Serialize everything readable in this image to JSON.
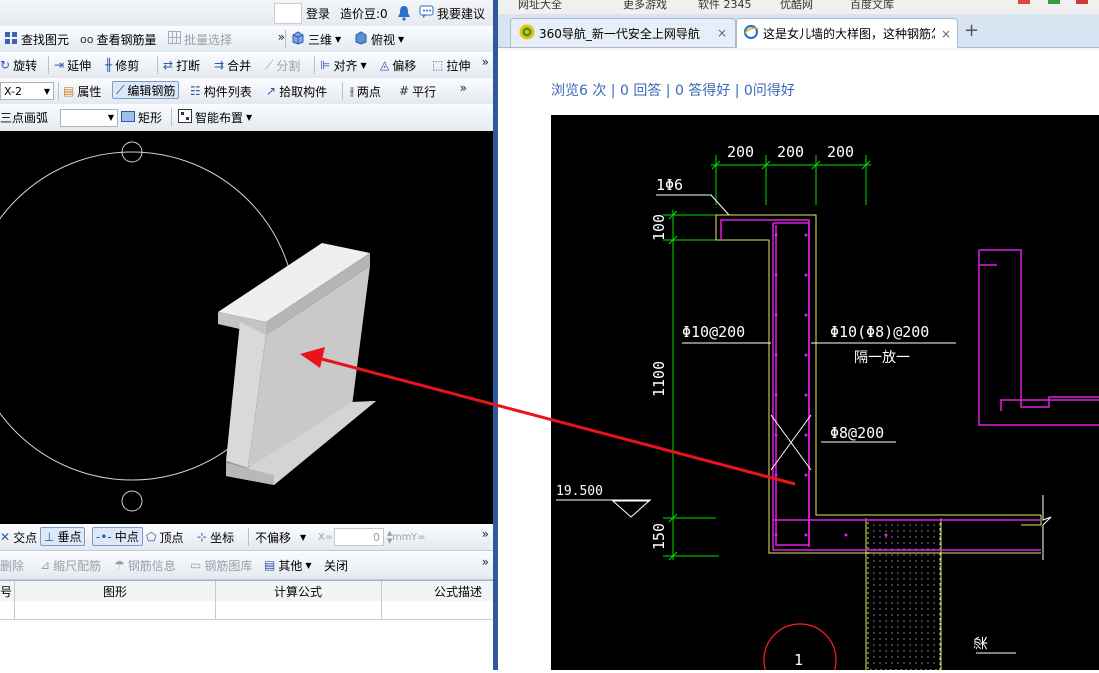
{
  "left_app": {
    "title_bar": {
      "login": "登录",
      "coins": "造价豆:0",
      "suggest": "我要建议"
    },
    "toolbar1": {
      "find": "查找图元",
      "view_rebar": "查看钢筋量",
      "batch_select": "批量选择",
      "view3d": "三维",
      "top_view": "俯视"
    },
    "toolbar2": {
      "rotate": "旋转",
      "extend": "延伸",
      "trim": "修剪",
      "break": "打断",
      "merge": "合并",
      "split": "分割",
      "align": "对齐",
      "offset": "偏移",
      "stretch": "拉伸"
    },
    "toolbar3": {
      "layer_combo": "X-2",
      "properties": "属性",
      "edit_rebar": "编辑钢筋",
      "component_list": "构件列表",
      "pick_component": "拾取构件",
      "two_points": "两点",
      "parallel": "平行"
    },
    "toolbar4": {
      "arc_combo": "三点画弧",
      "rectangle": "矩形",
      "smart_layout": "智能布置"
    },
    "snap_bar": {
      "intersection": "交点",
      "perpendicular": "垂点",
      "midpoint": "中点",
      "vertex": "顶点",
      "coordinate": "坐标",
      "offset_combo": "不偏移",
      "x_label": "X=",
      "x_value": "0",
      "unit": "mm",
      "y_label": "Y="
    },
    "rebar_bar": {
      "delete": "删除",
      "scale_config": "缩尺配筋",
      "rebar_info": "钢筋信息",
      "rebar_library": "钢筋图库",
      "other": "其他",
      "close": "关闭"
    },
    "table_headers": [
      "号",
      "图形",
      "计算公式",
      "公式描述"
    ]
  },
  "browser": {
    "bookmarks": [
      "网址大全",
      "更多游戏",
      "软件 2345",
      "优酷网",
      "百度文库"
    ],
    "tabs": [
      {
        "title": "360导航_新一代安全上网导航",
        "close": "×"
      },
      {
        "title": "这是女儿墙的大样图，这种钢筋怎",
        "close": "×"
      }
    ],
    "new_tab": "+",
    "stats": "浏览6 次 | 0 回答 | 0 答得好 | 0问得好",
    "cad": {
      "dims_top": [
        "200",
        "200",
        "200"
      ],
      "callout": "1Φ6",
      "dims_left": [
        "100",
        "1100",
        "150"
      ],
      "rebar_left": "Φ10@200",
      "rebar_right": "Φ10(Φ8)@200",
      "rebar_right_note": "隔一放一",
      "stirrup": "Φ8@200",
      "elevation": "19.500",
      "beam_label": "梁",
      "circle_label": "1"
    }
  },
  "colors": {
    "arrow": "#e8141c",
    "cad_green": "#00e000",
    "cad_magenta": "#e020e0",
    "cad_yellow": "#e8e860",
    "cad_white": "#ffffff",
    "link_blue": "#3a68b8"
  }
}
